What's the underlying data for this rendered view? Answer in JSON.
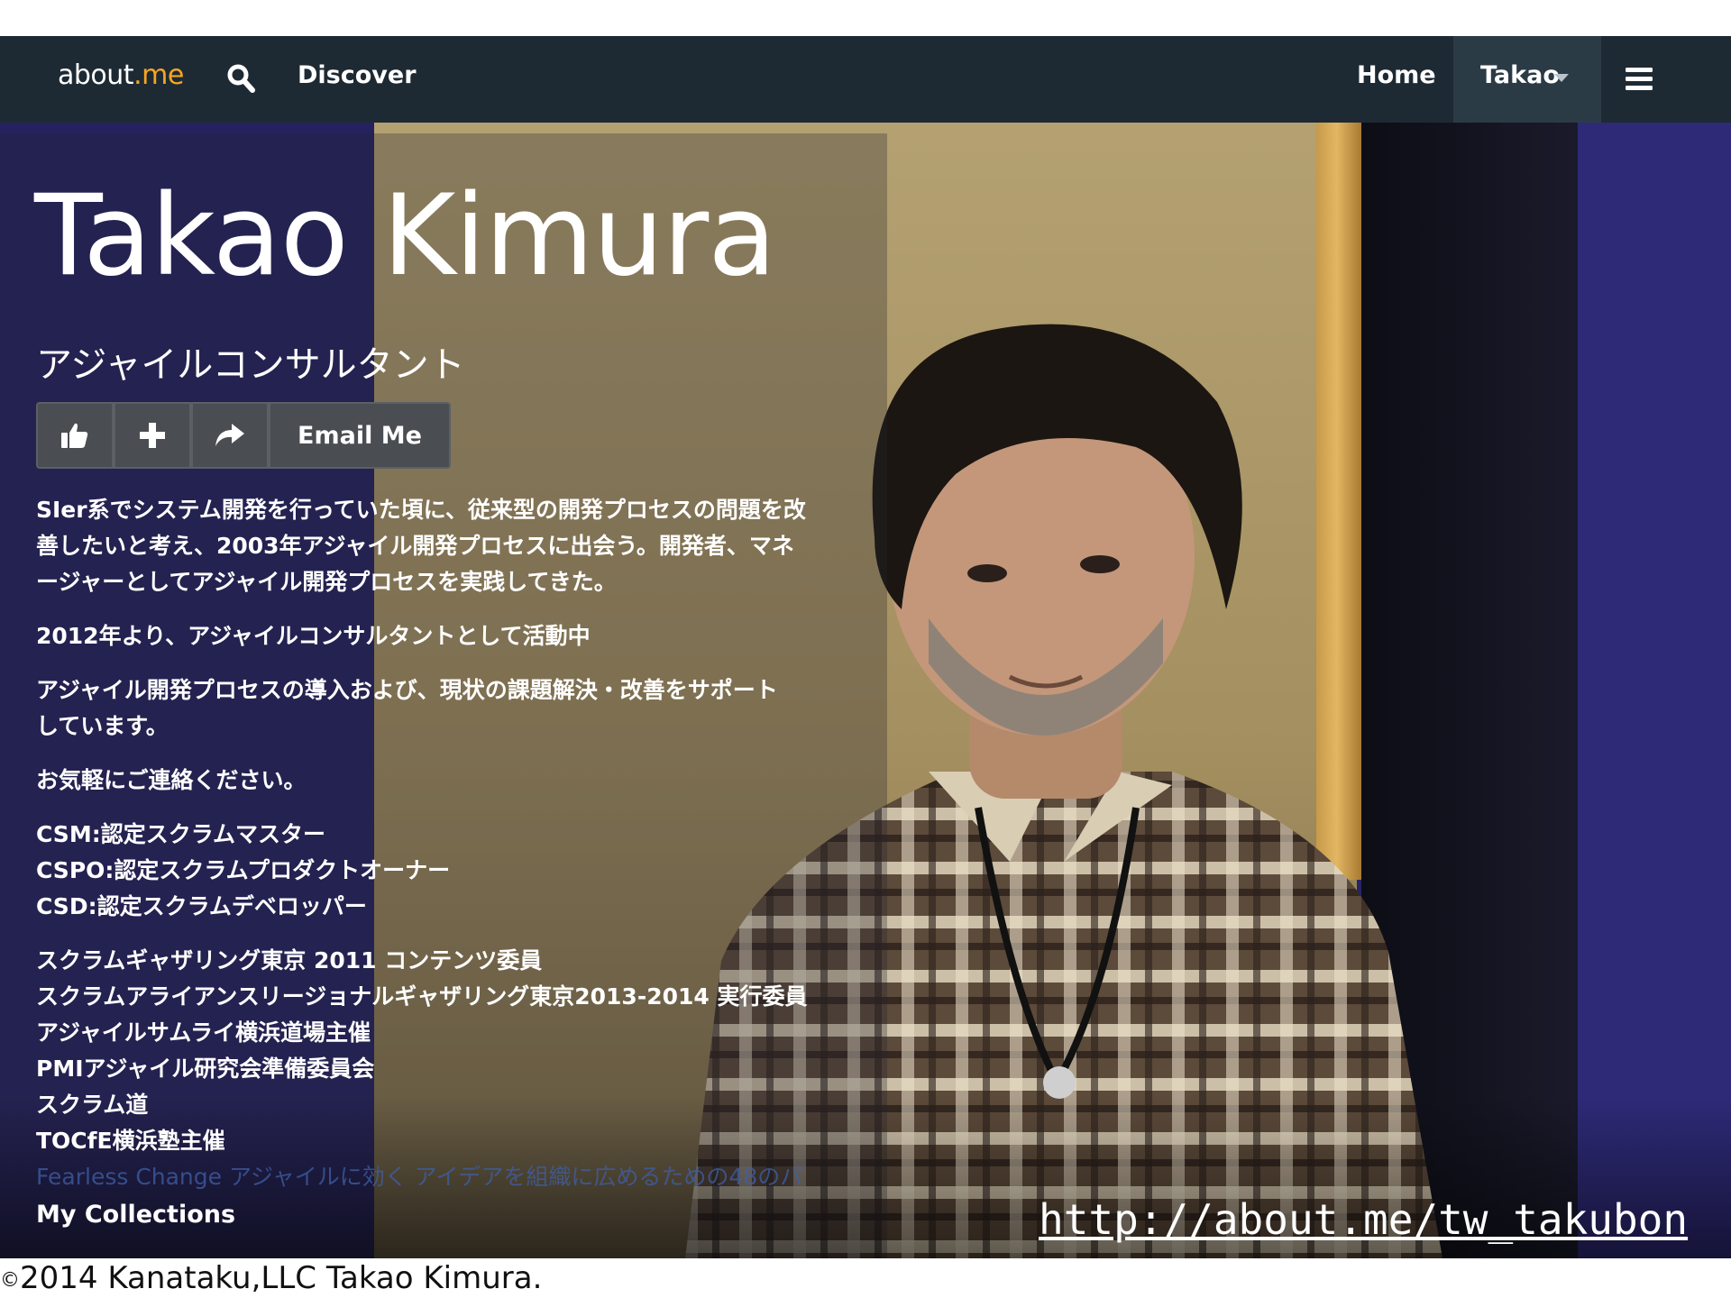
{
  "nav": {
    "logo_main": "about",
    "logo_accent": ".me",
    "discover_label": "Discover",
    "home_label": "Home",
    "user_label": "Takao",
    "icons": [
      "search-icon",
      "caret-down-icon",
      "menu-icon"
    ]
  },
  "profile": {
    "name": "Takao Kimura",
    "tagline": "アジャイルコンサルタント",
    "email_label": "Email Me",
    "action_icons": [
      "thumbs-up-icon",
      "plus-icon",
      "share-icon"
    ]
  },
  "bio": {
    "para1": [
      "SIer系でシステム開発を行っていた頃に、従来型の開発プロセスの問題を改",
      "善したいと考え、2003年アジャイル開発プロセスに出会う。開発者、マネ",
      "ージャーとしてアジャイル開発プロセスを実践してきた。"
    ],
    "para2": "2012年より、アジャイルコンサルタントとして活動中",
    "para3": [
      "アジャイル開発プロセスの導入および、現状の課題解決・改善をサポート",
      "しています。"
    ],
    "para4": "お気軽にご連絡ください。",
    "certs": [
      "CSM:認定スクラムマスター",
      "CSPO:認定スクラムプロダクトオーナー",
      "CSD:認定スクラムデベロッパー"
    ],
    "activities": [
      "スクラムギャザリング東京 2011 コンテンツ委員",
      "スクラムアライアンスリージョナルギャザリング東京2013-2014 実行委員",
      "アジャイルサムライ横浜道場主催",
      "PMIアジャイル研究会準備委員会",
      "スクラム道",
      "TOCfE横浜塾主催"
    ],
    "link_text": "Fearless Change アジャイルに効く アイデアを組織に広めるための48のパ"
  },
  "footer": {
    "my_collections": "My Collections",
    "url": "http://about.me/tw_takubon",
    "copyright_symbol": "©",
    "copyright_text": "2014 Kanataku,LLC Takao Kimura."
  },
  "colors": {
    "navbar": "#1e2a33",
    "logo_accent": "#f5a623",
    "background_band": "#25225f"
  }
}
